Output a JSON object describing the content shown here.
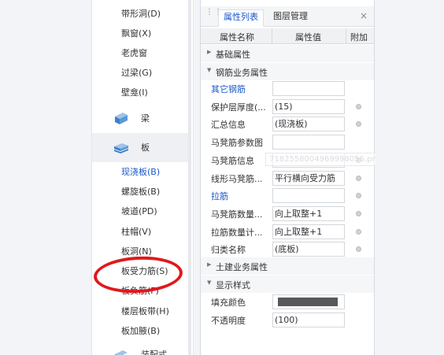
{
  "left_tree": {
    "items_top": [
      {
        "label": "带形洞(D)",
        "active": false
      },
      {
        "label": "飘窗(X)",
        "active": false
      },
      {
        "label": "老虎窗",
        "active": false
      },
      {
        "label": "过梁(G)",
        "active": false
      },
      {
        "label": "壁龛(I)",
        "active": false
      }
    ],
    "categories": [
      {
        "label": "梁",
        "icon": "beam-icon"
      },
      {
        "label": "板",
        "icon": "slab-icon"
      }
    ],
    "items_slab": [
      {
        "label": "现浇板(B)",
        "active": true
      },
      {
        "label": "螺旋板(B)",
        "active": false
      },
      {
        "label": "坡道(PD)",
        "active": false
      },
      {
        "label": "柱帽(V)",
        "active": false
      },
      {
        "label": "板洞(N)",
        "active": false
      },
      {
        "label": "板受力筋(S)",
        "active": false
      },
      {
        "label": "板负筋(F)",
        "active": false
      },
      {
        "label": "楼层板带(H)",
        "active": false
      },
      {
        "label": "板加腋(B)",
        "active": false
      }
    ],
    "bottom_partial": "装配式"
  },
  "prop_panel": {
    "tabs": [
      "属性列表",
      "图层管理"
    ],
    "columns": [
      "属性名称",
      "属性值",
      "附加"
    ],
    "groups": {
      "basic": "基础属性",
      "rebar": "钢筋业务属性",
      "civil": "土建业务属性",
      "display": "显示样式"
    },
    "rebar_rows": [
      {
        "name": "其它钢筋",
        "value": "",
        "link": true,
        "dot": false
      },
      {
        "name": "保护层厚度(...",
        "value": "(15)",
        "link": false,
        "dot": true
      },
      {
        "name": "汇总信息",
        "value": "(现浇板)",
        "link": false,
        "dot": true
      },
      {
        "name": "马凳筋参数图",
        "value": "",
        "link": false,
        "dot": false
      },
      {
        "name": "马凳筋信息",
        "value": "",
        "link": false,
        "dot": true
      },
      {
        "name": "线形马凳筋...",
        "value": "平行横向受力筋",
        "link": false,
        "dot": true
      },
      {
        "name": "拉筋",
        "value": "",
        "link": true,
        "dot": true
      },
      {
        "name": "马凳筋数量...",
        "value": "向上取整+1",
        "link": false,
        "dot": true
      },
      {
        "name": "拉筋数量计...",
        "value": "向上取整+1",
        "link": false,
        "dot": true
      },
      {
        "name": "归类名称",
        "value": "(底板)",
        "link": false,
        "dot": true
      }
    ],
    "display_rows": [
      {
        "name": "填充颜色",
        "swatch_color": "#585858"
      },
      {
        "name": "不透明度",
        "value": "(100)"
      }
    ],
    "tooltip_text": "7182558004969998056.png"
  },
  "colors": {
    "accent": "#1a56c9",
    "annotation": "#e0191c"
  }
}
